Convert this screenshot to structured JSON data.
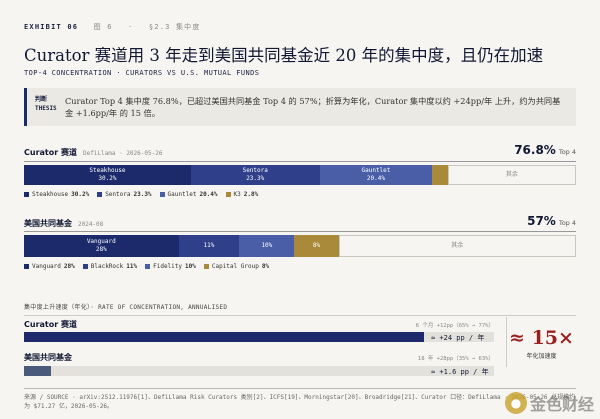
{
  "header": {
    "exhibit": "EXHIBIT 06",
    "fig": "图 6",
    "section_sign": "·",
    "section": "§2.3 集中度",
    "title": "Curator 赛道用 3 年走到美国共同基金近 20 年的集中度，且仍在加速",
    "subtitle": "TOP-4 CONCENTRATION · CURATORS VS U.S. MUTUAL FUNDS"
  },
  "thesis": {
    "tag_line1": "判断",
    "tag_line2": "THESIS",
    "text": "Curator Top 4 集中度 76.8%，已超过美国共同基金 Top 4 的 57%；折算为年化，Curator 集中度以约 +24pp/年 上升，约为共同基金 +1.6pp/年 的 15 倍。"
  },
  "colors": {
    "navy": "#1c2a6b",
    "blue": "#2f3f8a",
    "mid_blue": "#4a5ea8",
    "gold": "#a88a3a",
    "red": "#9c1f1f"
  },
  "chart_data": [
    {
      "type": "bar",
      "stacked": true,
      "title": "Curator 赛道",
      "source": "DefiLlama · 2026-05-26",
      "headline_value": "76.8%",
      "headline_label": "Top 4",
      "unit": "%",
      "segments": [
        {
          "name": "Steakhouse",
          "value": 30.2,
          "label": "30.2%",
          "color": "#1c2a6b"
        },
        {
          "name": "Sentora",
          "value": 23.3,
          "label": "23.3%",
          "color": "#2f3f8a"
        },
        {
          "name": "Gauntlet",
          "value": 20.4,
          "label": "20.4%",
          "color": "#4a5ea8"
        },
        {
          "name": "K3",
          "value": 2.8,
          "label": "2.8%",
          "color": "#a88a3a"
        },
        {
          "name": "其余",
          "value": 23.2,
          "label": "",
          "color": "#f6f5f1"
        }
      ]
    },
    {
      "type": "bar",
      "stacked": true,
      "title": "美国共同基金",
      "source": "2024-08",
      "headline_value": "57%",
      "headline_label": "Top 4",
      "unit": "%",
      "segments": [
        {
          "name": "Vanguard",
          "value": 28,
          "label": "28%",
          "color": "#1c2a6b"
        },
        {
          "name": "BlackRock",
          "value": 11,
          "label": "11%",
          "color": "#2f3f8a"
        },
        {
          "name": "Fidelity",
          "value": 10,
          "label": "10%",
          "color": "#4a5ea8"
        },
        {
          "name": "Capital Group",
          "value": 8,
          "label": "8%",
          "color": "#a88a3a"
        },
        {
          "name": "其余",
          "value": 43,
          "label": "",
          "color": "#f6f5f1"
        }
      ]
    },
    {
      "type": "bar",
      "orientation": "horizontal",
      "title": "集中度上升速度（年化）· RATE OF CONCENTRATION, ANNUALISED",
      "unit": "pp / 年",
      "series": [
        {
          "name": "Curator 赛道",
          "value": 24,
          "value_label": "≈ +24 pp / 年",
          "note": "6 个月 +12pp（65% → 77%）",
          "color": "#1c2a6b"
        },
        {
          "name": "美国共同基金",
          "value": 1.6,
          "value_label": "≈ +1.6 pp / 年",
          "note": "18 年 +28pp（35% → 63%）",
          "color": "#4a5a7a"
        }
      ],
      "multiple": {
        "approx": "≈",
        "value": "15×",
        "label": "年化加速度"
      }
    }
  ],
  "footer": {
    "text": "来源 / SOURCE · arXiv:2512.11976[1]、DefiLlama Risk Curators 类别[2]、ICFS[19]、Morningstar[20]、Broadridge[21]、Curator 口径：DefiLlama · 2026-05-26 总规模约为 $71.27 亿，2026-05-26。"
  },
  "watermark": {
    "text": "金色财经",
    "logo_icon": "gold-coin-icon"
  }
}
